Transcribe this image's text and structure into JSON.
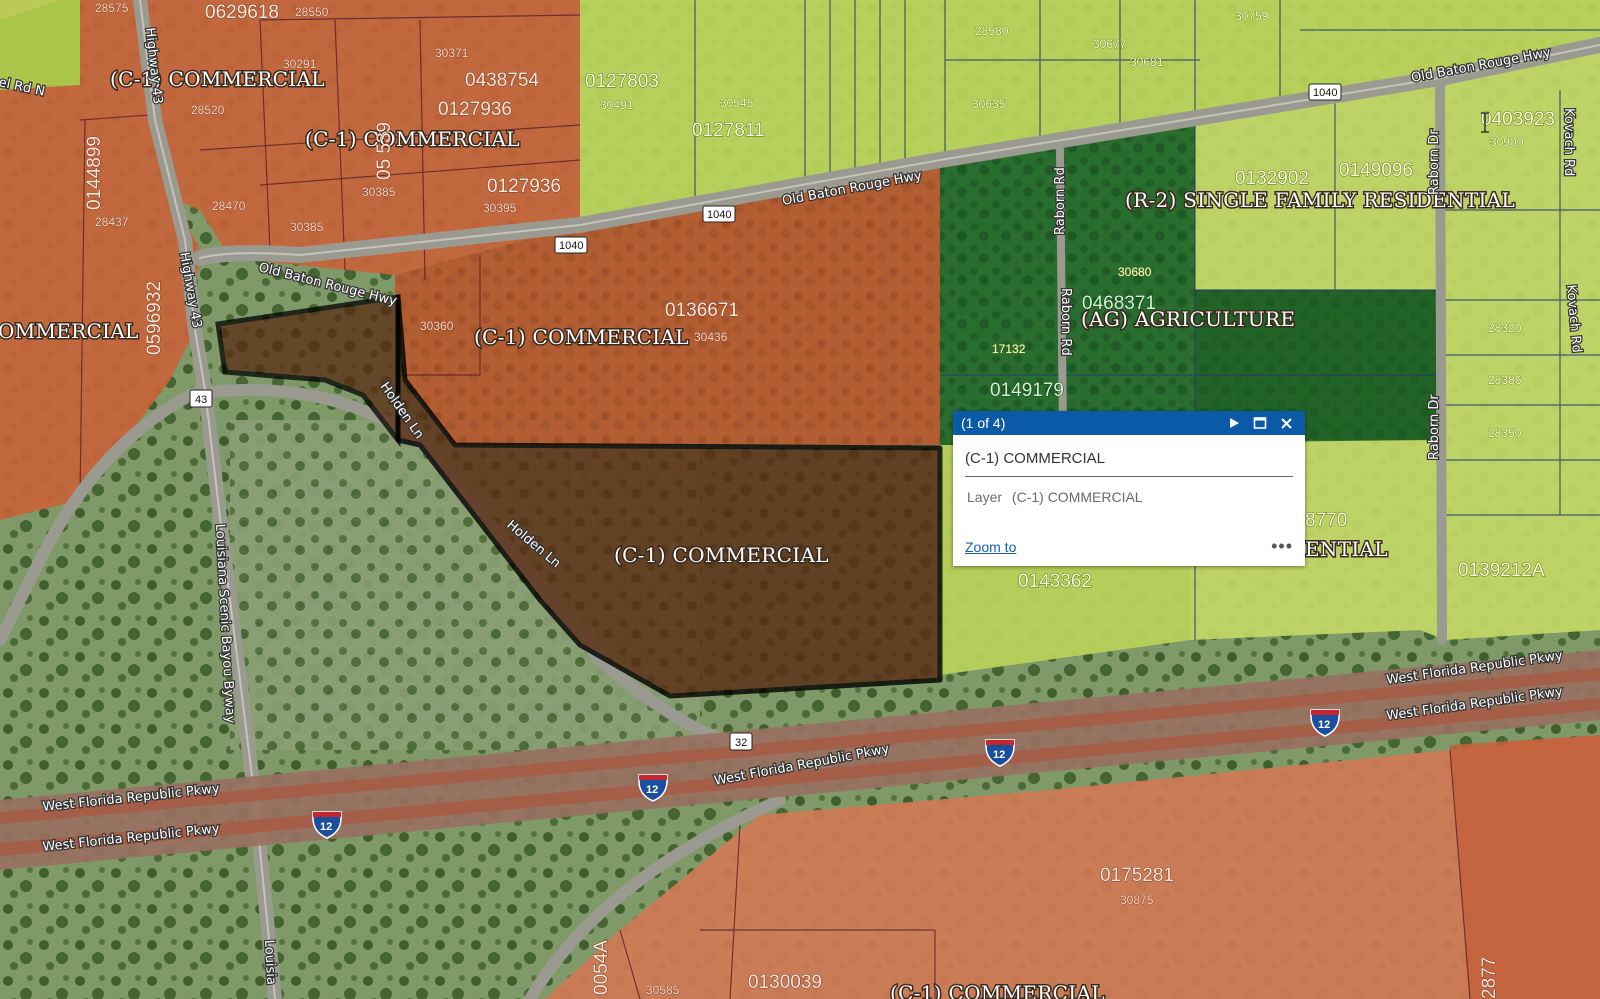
{
  "zones": {
    "c1_topleft": "(C-1) COMMERCIAL",
    "c1_top": "(C-1) COMMERCIAL",
    "c1_left": "OMMERCIAL",
    "c1_mid": "(C-1) COMMERCIAL",
    "c1_selected": "(C-1) COMMERCIAL",
    "ag": "(AG) AGRICULTURE",
    "r2": "(R-2) SINGLE FAMILY RESIDENTIAL",
    "r2_partial": "ENTIAL",
    "c1_bottom": "(C-1) COMMERCIAL"
  },
  "parcels": {
    "p0629618": "0629618",
    "p0438754": "0438754",
    "p0127936a": "0127936",
    "p0127936b": "0127936",
    "p0144899": "0144899",
    "p0596932": "0596932",
    "p05539": "05 539",
    "p0127803": "0127803",
    "p0127811": "0127811",
    "p0136671": "0136671",
    "p0132902": "0132902",
    "p0149096": "0149096",
    "p0403923": "0403923",
    "p0468371": "0468371",
    "p0149179": "0149179",
    "p8770": "8770",
    "p0143362": "0143362",
    "p0139212A": "0139212A",
    "p0175281": "0175281",
    "p0130039": "0130039",
    "p0054A": "0054A",
    "p2877": "2877"
  },
  "addresses": {
    "a28575": "28575",
    "a28550": "28550",
    "a30371": "30371",
    "a30291": "30291",
    "a28520": "28520",
    "a28470": "28470",
    "a30385a": "30385",
    "a30385b": "30385",
    "a30395": "30395",
    "a28437": "28437",
    "a30491": "30491",
    "a30545": "30545",
    "a30580": "28580",
    "a30677": "30677",
    "a30759": "30759",
    "a30681": "30681",
    "a30635": "30635",
    "a30900": "30900",
    "a30360": "30360",
    "a30436": "30436",
    "a30680": "30680",
    "a17132": "17132",
    "a28320": "28320",
    "a28386": "28386",
    "a28350": "28350",
    "a30875": "30875",
    "a30585": "30585"
  },
  "roads": {
    "obr_top": "Old Baton Rouge Hwy",
    "obr_mid": "Old Baton Rouge Hwy",
    "obr_left": "Old Baton Rouge Hwy",
    "hwy43_top": "Highway 43",
    "hwy43_mid": "Highway 43",
    "raborn1": "Raborn Rd",
    "raborn2": "Raborn Rd",
    "raborn_dr1": "Raborn Dr",
    "raborn_dr2": "Raborn Dr",
    "kovach1": "Kovach Rd",
    "kovach2": "Kovach Rd",
    "holden1": "Holden Ln",
    "holden2": "Holden Ln",
    "scenic1": "Louisiana Scenic Bayou Byway",
    "scenic2": "Louisia",
    "wfr1": "West Florida Republic Pkwy",
    "wfr2": "West Florida Republic Pkwy",
    "wfr3": "West Florida Republic Pkwy",
    "wfr4": "West Florida Republic Pkwy",
    "wfr5": "West Florida Republic Pkwy",
    "chapel": "el Rd N"
  },
  "shields": {
    "s1040a": "1040",
    "s1040b": "1040",
    "s1040c": "1040",
    "s43": "43",
    "s32": "32",
    "i12a": "12",
    "i12b": "12",
    "i12c": "12",
    "i12d": "12"
  },
  "popup": {
    "count": "(1 of 4)",
    "title": "(C-1) COMMERCIAL",
    "attr_key": "Layer",
    "attr_value": "(C-1) COMMERCIAL",
    "zoom_to": "Zoom to",
    "more": "•••"
  },
  "colors": {
    "commercial": "#c8643c",
    "residential": "#bcd45a",
    "agriculture": "#1f6b2a",
    "selected": "#5a2c14",
    "popup_header": "#0a5aa8"
  }
}
